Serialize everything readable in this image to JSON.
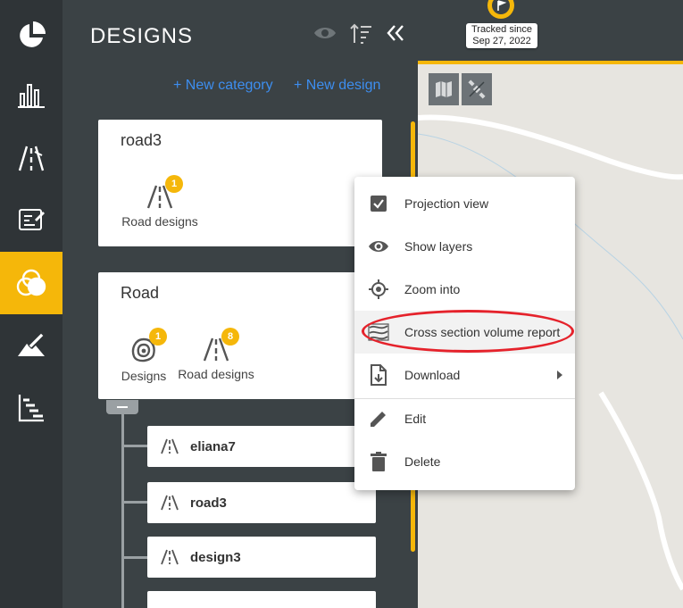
{
  "rail": {
    "items": [
      {
        "icon": "pie-chart-icon"
      },
      {
        "icon": "bar-chart-icon"
      },
      {
        "icon": "road-measure-icon"
      },
      {
        "icon": "report-edit-icon"
      },
      {
        "icon": "layers-circles-icon",
        "active": true
      },
      {
        "icon": "terrain-edit-icon"
      },
      {
        "icon": "timeline-icon"
      }
    ]
  },
  "panel": {
    "title": "DESIGNS",
    "new_category": "+ New category",
    "new_design": "+ New design"
  },
  "cards": [
    {
      "title": "road3",
      "types": [
        {
          "label": "Road designs",
          "count": "1"
        }
      ]
    },
    {
      "title": "Road",
      "types": [
        {
          "label": "Designs",
          "count": "1"
        },
        {
          "label": "Road designs",
          "count": "8"
        }
      ]
    }
  ],
  "tree": [
    {
      "label": "eliana7"
    },
    {
      "label": "road3"
    },
    {
      "label": "design3"
    }
  ],
  "map": {
    "tracked_line1": "Tracked since",
    "tracked_line2": "Sep 27, 2022"
  },
  "context_menu": {
    "items": [
      {
        "label": "Projection view",
        "icon": "checkbox-icon"
      },
      {
        "label": "Show layers",
        "icon": "eye-icon"
      },
      {
        "label": "Zoom into",
        "icon": "target-icon"
      },
      {
        "label": "Cross section volume report",
        "icon": "cross-section-icon"
      },
      {
        "label": "Download",
        "icon": "download-file-icon"
      },
      {
        "label": "Edit",
        "icon": "pencil-icon"
      },
      {
        "label": "Delete",
        "icon": "trash-icon"
      }
    ]
  },
  "colors": {
    "accent": "#f5b70a",
    "link": "#3d8ef0",
    "highlight_ellipse": "#e5222b"
  }
}
